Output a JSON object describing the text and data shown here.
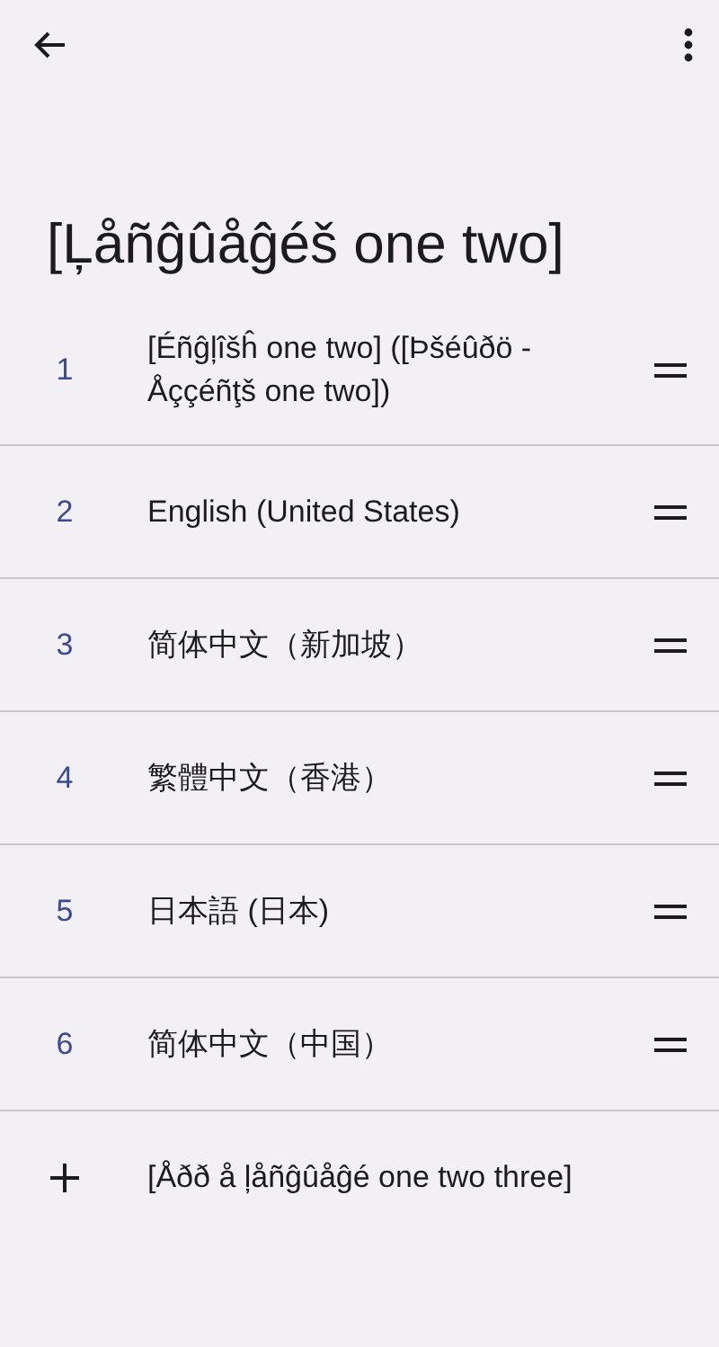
{
  "title": "[Ļåñĝûåĝéš one two]",
  "languages": [
    {
      "number": "1",
      "name": "[Éñĝļîšĥ one two] ([Þšéûðö - Åççéñţš one two])"
    },
    {
      "number": "2",
      "name": "English (United States)"
    },
    {
      "number": "3",
      "name": "简体中文（新加坡）"
    },
    {
      "number": "4",
      "name": "繁體中文（香港）"
    },
    {
      "number": "5",
      "name": "日本語 (日本)"
    },
    {
      "number": "6",
      "name": "简体中文（中国）"
    }
  ],
  "add_language": "[Åðð å ļåñĝûåĝé one two three]"
}
